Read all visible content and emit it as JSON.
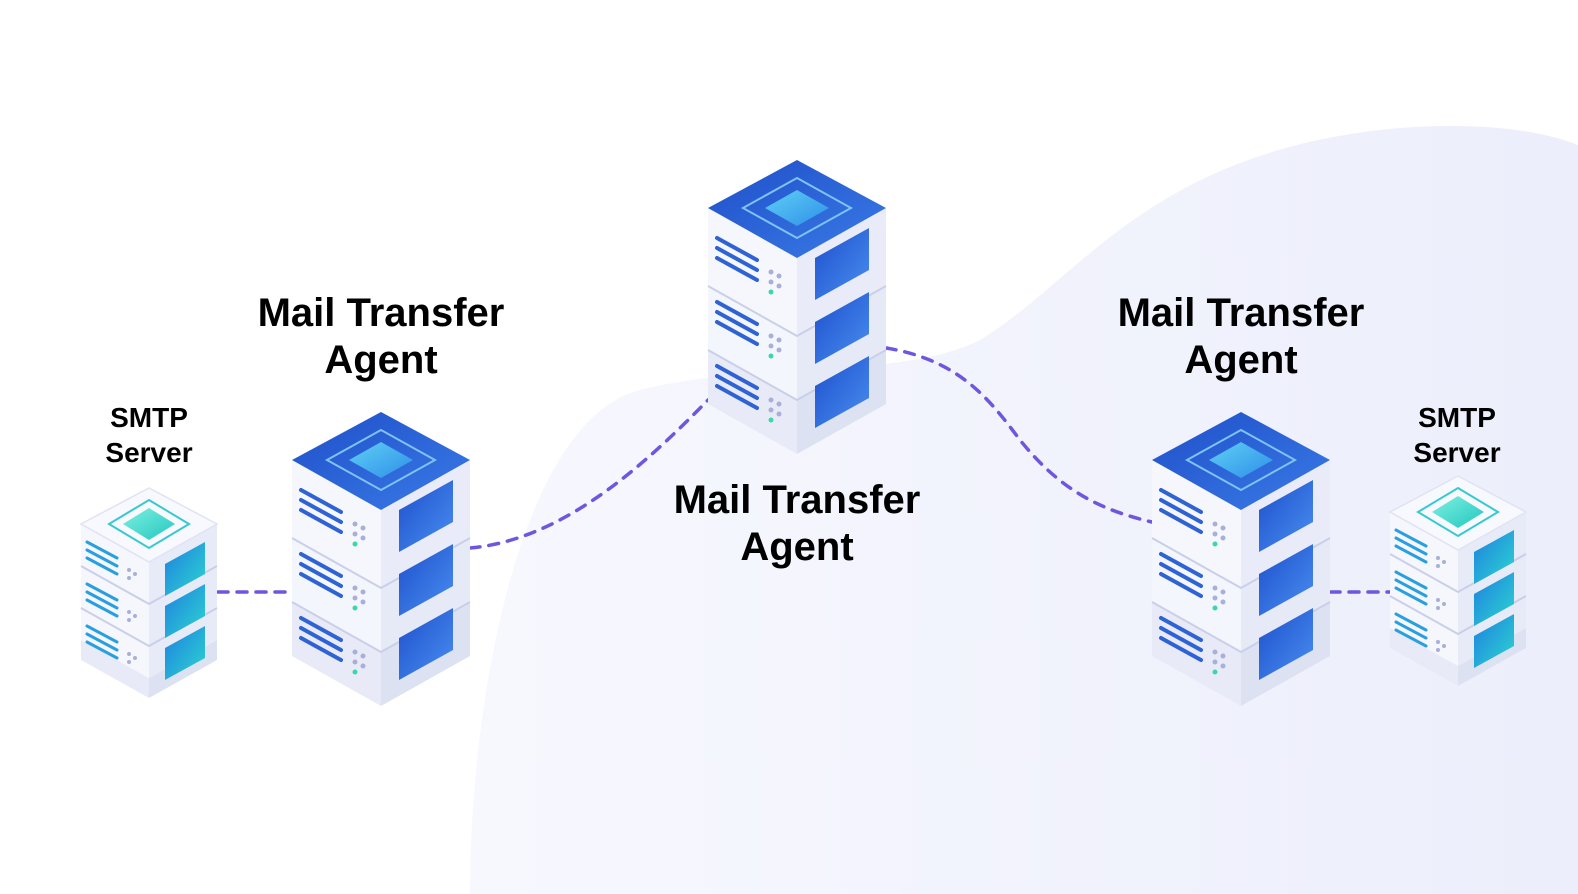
{
  "labels": {
    "smtp_left": {
      "line1": "SMTP",
      "line2": "Server"
    },
    "mta_left": {
      "line1": "Mail Transfer",
      "line2": "Agent"
    },
    "mta_center": {
      "line1": "Mail Transfer",
      "line2": "Agent"
    },
    "mta_right": {
      "line1": "Mail Transfer",
      "line2": "Agent"
    },
    "smtp_right": {
      "line1": "SMTP",
      "line2": "Server"
    }
  },
  "colors": {
    "background_blob": "#eef0fb",
    "connector": "#6f56de",
    "server_body": "#f3f5fc",
    "server_side": "#dfe4f4",
    "mta_top": "#2a5bd7",
    "mta_panel": "#3b78e0",
    "smtp_accent": "#2cd1c9"
  }
}
